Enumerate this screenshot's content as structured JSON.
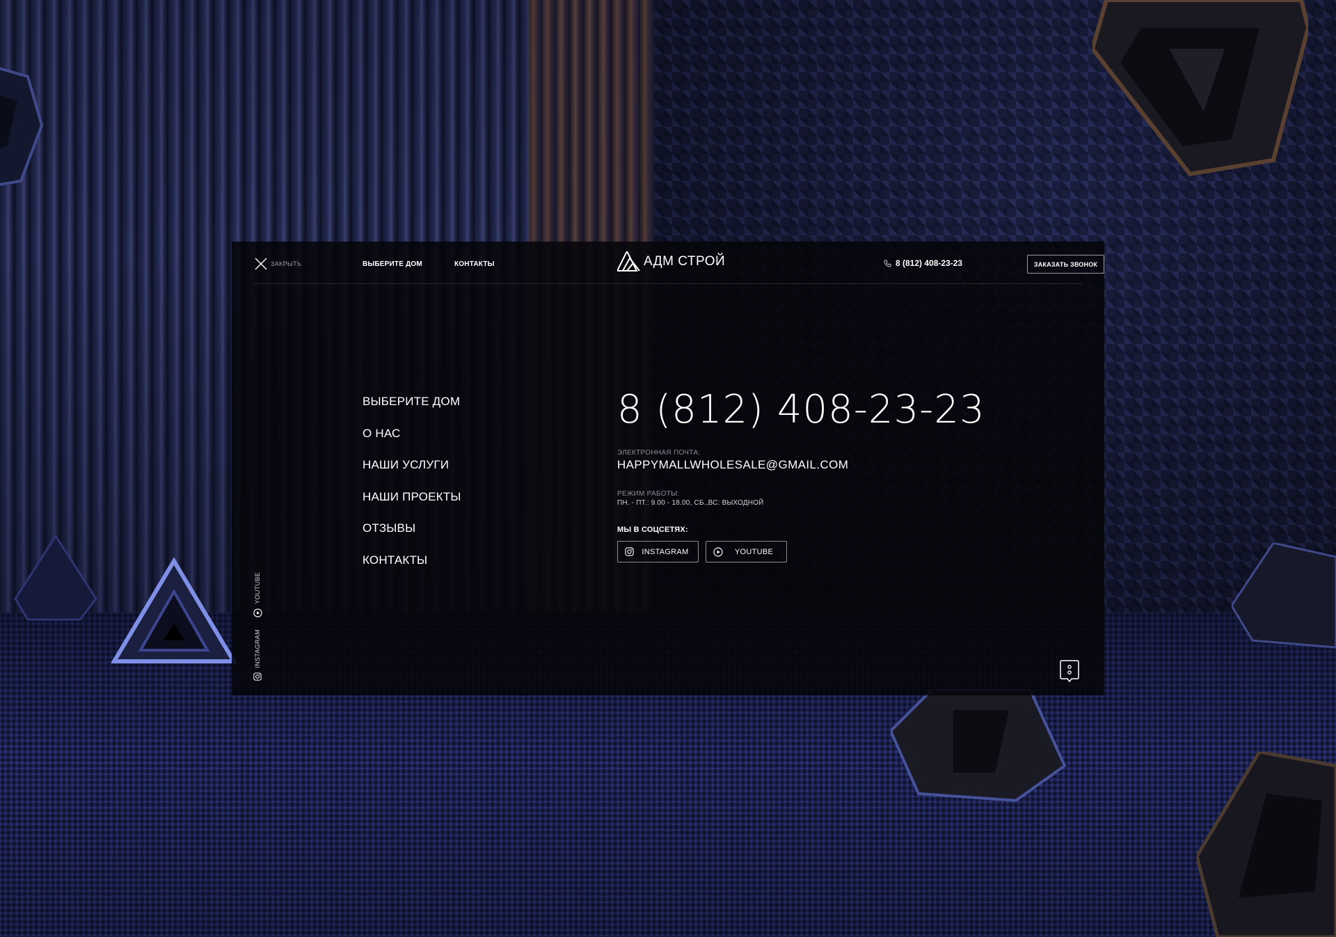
{
  "header": {
    "close_label": "ЗАКРЫТЬ",
    "nav": [
      {
        "label": "ВЫБЕРИТЕ ДОМ"
      },
      {
        "label": "КОНТАКТЫ"
      }
    ],
    "logo_text": "АДМ СТРОЙ",
    "phone": "8 (812) 408-23-23",
    "callback_label": "ЗАКАЗАТЬ ЗВОНОК"
  },
  "menu": {
    "items": [
      {
        "label": "ВЫБЕРИТЕ ДОМ"
      },
      {
        "label": "О НАС"
      },
      {
        "label": "НАШИ УСЛУГИ"
      },
      {
        "label": "НАШИ ПРОЕКТЫ"
      },
      {
        "label": "ОТЗЫВЫ"
      },
      {
        "label": "КОНТАКТЫ"
      }
    ]
  },
  "contact": {
    "phone": "8 (812) 408-23-23",
    "email_label": "ЭЛЕКТРОННАЯ ПОЧТА:",
    "email": "HAPPYMALLWHOLESALE@GMAIL.COM",
    "hours_label": "РЕЖИМ РАБОТЫ:",
    "hours": "ПН. - ПТ.: 9.00 - 18.00, СБ.,ВС: ВЫХОДНОЙ",
    "social_heading": "МЫ В СОЦСЕТЯХ:",
    "social": [
      {
        "label": "INSTAGRAM",
        "icon": "instagram-icon"
      },
      {
        "label": "YOUTUBE",
        "icon": "youtube-icon"
      }
    ]
  },
  "side_social": [
    {
      "label": "YOUTUBE",
      "icon": "youtube-icon"
    },
    {
      "label": "INSTAGRAM",
      "icon": "instagram-icon"
    }
  ],
  "colors": {
    "overlay": "#06060a",
    "text": "#ffffff",
    "muted": "#8d8d96",
    "accent_background": "#1b2150"
  }
}
